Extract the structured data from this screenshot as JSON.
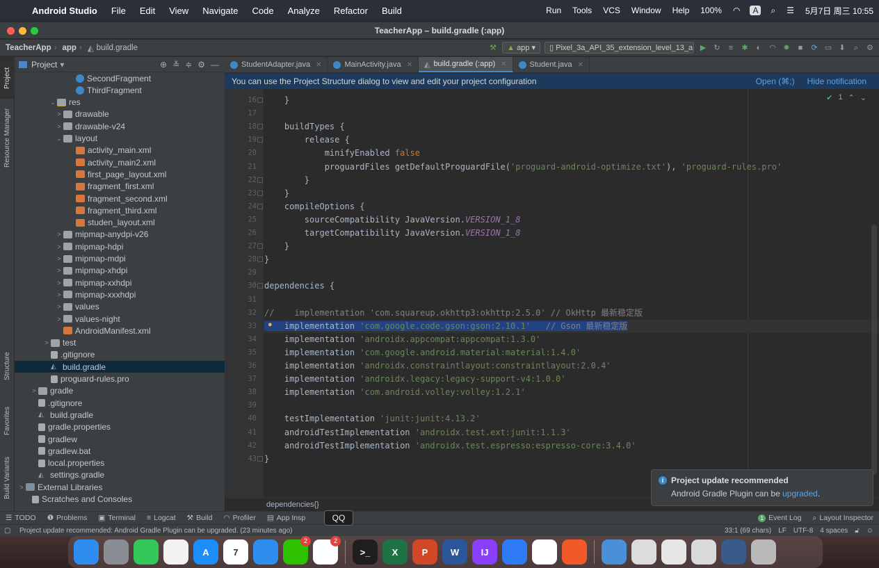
{
  "menubar": {
    "app_name": "Android Studio",
    "items": [
      "File",
      "Edit",
      "View",
      "Navigate",
      "Code",
      "Analyze",
      "Refactor",
      "Build"
    ],
    "right_items": [
      "Run",
      "Tools",
      "VCS",
      "Window",
      "Help"
    ],
    "battery": "100%",
    "input_method": "A",
    "datetime": "5月7日 周三 10:55"
  },
  "window": {
    "title": "TeacherApp – build.gradle (:app)"
  },
  "navbar": {
    "project": "TeacherApp",
    "module": "app",
    "file": "build.gradle",
    "run_config": "app",
    "device": "Pixel_3a_API_35_extension_level_13_a"
  },
  "left_strip": {
    "tabs": [
      "Project",
      "Resource Manager",
      "Structure",
      "Favorites",
      "Build Variants"
    ]
  },
  "project_pane": {
    "title": "Project",
    "tree": [
      {
        "label": "SecondFragment",
        "indent": 8,
        "icon": "cls",
        "arrow": ""
      },
      {
        "label": "ThirdFragment",
        "indent": 8,
        "icon": "cls",
        "arrow": ""
      },
      {
        "label": "res",
        "indent": 5,
        "icon": "resfolder",
        "arrow": "⌄"
      },
      {
        "label": "drawable",
        "indent": 6,
        "icon": "folder",
        "arrow": ">"
      },
      {
        "label": "drawable-v24",
        "indent": 6,
        "icon": "folder",
        "arrow": ">"
      },
      {
        "label": "layout",
        "indent": 6,
        "icon": "folder",
        "arrow": "⌄"
      },
      {
        "label": "activity_main.xml",
        "indent": 8,
        "icon": "xml",
        "arrow": ""
      },
      {
        "label": "activity_main2.xml",
        "indent": 8,
        "icon": "xml",
        "arrow": ""
      },
      {
        "label": "first_page_layout.xml",
        "indent": 8,
        "icon": "xml",
        "arrow": ""
      },
      {
        "label": "fragment_first.xml",
        "indent": 8,
        "icon": "xml",
        "arrow": ""
      },
      {
        "label": "fragment_second.xml",
        "indent": 8,
        "icon": "xml",
        "arrow": ""
      },
      {
        "label": "fragment_third.xml",
        "indent": 8,
        "icon": "xml",
        "arrow": ""
      },
      {
        "label": "studen_layout.xml",
        "indent": 8,
        "icon": "xml",
        "arrow": ""
      },
      {
        "label": "mipmap-anydpi-v26",
        "indent": 6,
        "icon": "folder",
        "arrow": ">"
      },
      {
        "label": "mipmap-hdpi",
        "indent": 6,
        "icon": "folder",
        "arrow": ">"
      },
      {
        "label": "mipmap-mdpi",
        "indent": 6,
        "icon": "folder",
        "arrow": ">"
      },
      {
        "label": "mipmap-xhdpi",
        "indent": 6,
        "icon": "folder",
        "arrow": ">"
      },
      {
        "label": "mipmap-xxhdpi",
        "indent": 6,
        "icon": "folder",
        "arrow": ">"
      },
      {
        "label": "mipmap-xxxhdpi",
        "indent": 6,
        "icon": "folder",
        "arrow": ">"
      },
      {
        "label": "values",
        "indent": 6,
        "icon": "folder",
        "arrow": ">"
      },
      {
        "label": "values-night",
        "indent": 6,
        "icon": "folder",
        "arrow": ">"
      },
      {
        "label": "AndroidManifest.xml",
        "indent": 6,
        "icon": "xml",
        "arrow": ""
      },
      {
        "label": "test",
        "indent": 4,
        "icon": "folder",
        "arrow": ">"
      },
      {
        "label": ".gitignore",
        "indent": 4,
        "icon": "file",
        "arrow": ""
      },
      {
        "label": "build.gradle",
        "indent": 4,
        "icon": "gradle",
        "arrow": "",
        "selected": true
      },
      {
        "label": "proguard-rules.pro",
        "indent": 4,
        "icon": "file",
        "arrow": ""
      },
      {
        "label": "gradle",
        "indent": 2,
        "icon": "folder",
        "arrow": ">"
      },
      {
        "label": ".gitignore",
        "indent": 2,
        "icon": "file",
        "arrow": ""
      },
      {
        "label": "build.gradle",
        "indent": 2,
        "icon": "gradle",
        "arrow": ""
      },
      {
        "label": "gradle.properties",
        "indent": 2,
        "icon": "file",
        "arrow": ""
      },
      {
        "label": "gradlew",
        "indent": 2,
        "icon": "file",
        "arrow": ""
      },
      {
        "label": "gradlew.bat",
        "indent": 2,
        "icon": "file",
        "arrow": ""
      },
      {
        "label": "local.properties",
        "indent": 2,
        "icon": "file",
        "arrow": ""
      },
      {
        "label": "settings.gradle",
        "indent": 2,
        "icon": "gradle",
        "arrow": ""
      },
      {
        "label": "External Libraries",
        "indent": 0,
        "icon": "lib",
        "arrow": ">"
      },
      {
        "label": "Scratches and Consoles",
        "indent": 1,
        "icon": "file",
        "arrow": ""
      }
    ]
  },
  "tabs": [
    {
      "label": "StudentAdapter.java",
      "active": false
    },
    {
      "label": "MainActivity.java",
      "active": false
    },
    {
      "label": "build.gradle (:app)",
      "active": true
    },
    {
      "label": "Student.java",
      "active": false
    }
  ],
  "notification_bar": {
    "text": "You can use the Project Structure dialog to view and edit your project configuration",
    "open_label": "Open (⌘;)",
    "hide_label": "Hide notification"
  },
  "inspection": {
    "count": "1"
  },
  "code": {
    "current_line": 33,
    "lines": [
      {
        "n": 16,
        "segs": [
          [
            "p",
            "    }"
          ]
        ]
      },
      {
        "n": 17,
        "segs": []
      },
      {
        "n": 18,
        "segs": [
          [
            "p",
            "    buildTypes {"
          ]
        ]
      },
      {
        "n": 19,
        "segs": [
          [
            "p",
            "        release {"
          ]
        ]
      },
      {
        "n": 20,
        "segs": [
          [
            "p",
            "            minifyEnabled "
          ],
          [
            "kw",
            "false"
          ]
        ]
      },
      {
        "n": 21,
        "segs": [
          [
            "p",
            "            proguardFiles getDefaultProguardFile("
          ],
          [
            "str",
            "'proguard-android-optimize.txt'"
          ],
          [
            "p",
            "), "
          ],
          [
            "str",
            "'proguard-rules.pro'"
          ]
        ]
      },
      {
        "n": 22,
        "segs": [
          [
            "p",
            "        }"
          ]
        ]
      },
      {
        "n": 23,
        "segs": [
          [
            "p",
            "    }"
          ]
        ]
      },
      {
        "n": 24,
        "segs": [
          [
            "p",
            "    compileOptions {"
          ]
        ]
      },
      {
        "n": 25,
        "segs": [
          [
            "p",
            "        sourceCompatibility JavaVersion."
          ],
          [
            "ital",
            "VERSION_1_8"
          ]
        ]
      },
      {
        "n": 26,
        "segs": [
          [
            "p",
            "        targetCompatibility JavaVersion."
          ],
          [
            "ital",
            "VERSION_1_8"
          ]
        ]
      },
      {
        "n": 27,
        "segs": [
          [
            "p",
            "    }"
          ]
        ]
      },
      {
        "n": 28,
        "segs": [
          [
            "p",
            "}"
          ]
        ]
      },
      {
        "n": 29,
        "segs": []
      },
      {
        "n": 30,
        "segs": [
          [
            "p",
            "dependencies {"
          ]
        ]
      },
      {
        "n": 31,
        "segs": []
      },
      {
        "n": 32,
        "segs": [
          [
            "cmt",
            "//    implementation 'com.squareup.okhttp3:okhttp:2.5.0' // OkHttp 最新稳定版"
          ]
        ]
      },
      {
        "n": 33,
        "segs": [
          [
            "sel",
            "    implementation "
          ],
          [
            "selstr",
            "'com.google.code.gson:gson:2.10.1'"
          ],
          [
            "selcmt",
            "   // Gson 最新稳定版"
          ]
        ]
      },
      {
        "n": 34,
        "segs": [
          [
            "p",
            "    implementation "
          ],
          [
            "str",
            "'androidx.appcompat:appcompat:1.3.0'"
          ]
        ]
      },
      {
        "n": 35,
        "segs": [
          [
            "p",
            "    implementation "
          ],
          [
            "str",
            "'com.google.android.material:material:1.4.0'"
          ]
        ]
      },
      {
        "n": 36,
        "segs": [
          [
            "p",
            "    implementation "
          ],
          [
            "str",
            "'androidx.constraintlayout:constraintlayout:2.0.4'"
          ]
        ]
      },
      {
        "n": 37,
        "segs": [
          [
            "p",
            "    implementation "
          ],
          [
            "str",
            "'androidx.legacy:legacy-support-v4:1.0.0'"
          ]
        ]
      },
      {
        "n": 38,
        "segs": [
          [
            "p",
            "    implementation "
          ],
          [
            "str",
            "'com.android.volley:volley:1.2.1'"
          ]
        ]
      },
      {
        "n": 39,
        "segs": []
      },
      {
        "n": 40,
        "segs": [
          [
            "p",
            "    testImplementation "
          ],
          [
            "str",
            "'junit:junit:4.13.2'"
          ]
        ]
      },
      {
        "n": 41,
        "segs": [
          [
            "p",
            "    androidTestImplementation "
          ],
          [
            "str",
            "'androidx.test.ext:junit:1.1.3'"
          ]
        ]
      },
      {
        "n": 42,
        "segs": [
          [
            "p",
            "    androidTestImplementation "
          ],
          [
            "str",
            "'androidx.test.espresso:espresso-core:3.4.0'"
          ]
        ]
      },
      {
        "n": 43,
        "segs": [
          [
            "p",
            "}"
          ]
        ]
      }
    ]
  },
  "editor_breadcrumb": "dependencies{}",
  "popup": {
    "title": "Project update recommended",
    "body_prefix": "Android Gradle Plugin can be ",
    "link": "upgraded",
    "body_suffix": "."
  },
  "bottom_tabs": [
    "TODO",
    "Problems",
    "Terminal",
    "Logcat",
    "Build",
    "Profiler",
    "App Insp"
  ],
  "bottom_right_tabs": [
    "Event Log",
    "Layout Inspector"
  ],
  "event_log_count": "1",
  "status": {
    "message": "Project update recommended: Android Gradle Plugin can be upgraded. (23 minutes ago)",
    "position": "33:1 (69 chars)",
    "line_sep": "LF",
    "encoding": "UTF-8",
    "indent": "4 spaces"
  },
  "tooltip": "QQ",
  "dock": [
    {
      "name": "finder-icon",
      "label": "",
      "color": "#2d8ef0"
    },
    {
      "name": "launchpad-icon",
      "label": "",
      "color": "#8a8d93"
    },
    {
      "name": "messages-icon",
      "label": "",
      "color": "#34c759"
    },
    {
      "name": "notes-icon",
      "label": "",
      "color": "#f2f2f2"
    },
    {
      "name": "app-store-icon",
      "label": "A",
      "color": "#1c8ef9"
    },
    {
      "name": "calendar-icon",
      "label": "7",
      "color": "#ffffff"
    },
    {
      "name": "safari-icon",
      "label": "",
      "color": "#2d8ef0"
    },
    {
      "name": "wechat-icon",
      "label": "",
      "color": "#2dc100",
      "badge": "2"
    },
    {
      "name": "qq-icon",
      "label": "",
      "color": "#ffffff",
      "badge": "2"
    },
    {
      "sep": true
    },
    {
      "name": "terminal-icon",
      "label": ">_",
      "color": "#1e1e1e"
    },
    {
      "name": "excel-icon",
      "label": "X",
      "color": "#1e7145"
    },
    {
      "name": "powerpoint-icon",
      "label": "P",
      "color": "#d24726"
    },
    {
      "name": "word-icon",
      "label": "W",
      "color": "#2b579a"
    },
    {
      "name": "intellij-icon",
      "label": "IJ",
      "color": "#8a3ffc"
    },
    {
      "name": "meeting-icon",
      "label": "",
      "color": "#2f7bf5"
    },
    {
      "name": "android-studio-icon",
      "label": "",
      "color": "#ffffff"
    },
    {
      "name": "pen-app-icon",
      "label": "",
      "color": "#f05a28"
    },
    {
      "sep": true
    },
    {
      "name": "downloads-folder-icon",
      "label": "",
      "color": "#4a90d9"
    },
    {
      "name": "window-thumb-icon",
      "label": "",
      "color": "#dcdcdc"
    },
    {
      "name": "window-thumb-icon",
      "label": "",
      "color": "#e6e6e6"
    },
    {
      "name": "window-thumb-icon",
      "label": "",
      "color": "#d9d9d9"
    },
    {
      "name": "window-thumb-icon",
      "label": "",
      "color": "#3a5a8a"
    },
    {
      "name": "trash-icon",
      "label": "",
      "color": "#b9b9b9"
    }
  ],
  "colors": {
    "accent": "#4a88c7",
    "selection": "#214283",
    "string": "#6a8759",
    "keyword": "#cc7832"
  }
}
